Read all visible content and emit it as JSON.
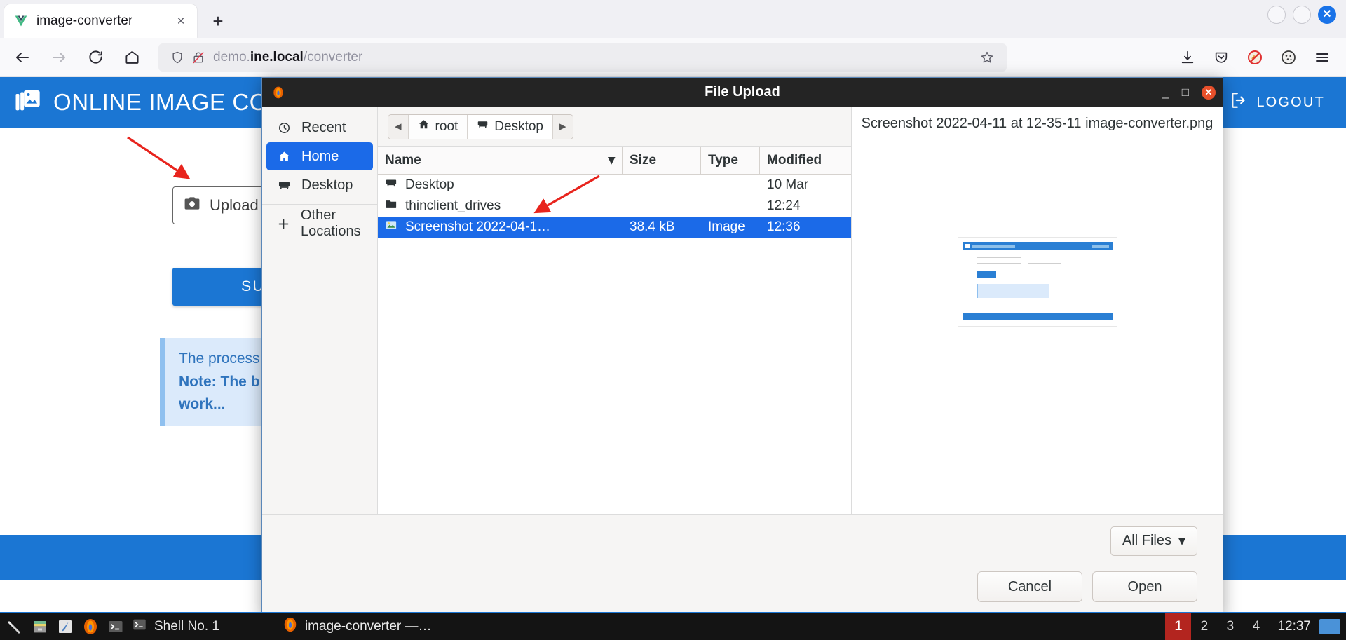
{
  "browser": {
    "tab": {
      "title": "image-converter",
      "favicon": "vue-logo-icon",
      "close": "×"
    },
    "new_tab_label": "+",
    "window_controls": {
      "minimize": "",
      "maximize": "",
      "close": "✕"
    },
    "nav": {
      "back": "back-arrow-icon",
      "forward": "forward-arrow-icon",
      "reload": "reload-icon",
      "home": "home-icon"
    },
    "url": {
      "prefix": "demo.",
      "domain": "ine.local",
      "path": "/converter",
      "full": "demo.ine.local/converter"
    },
    "url_icons": {
      "shield": "shield-icon",
      "lock": "lock-crossed-icon",
      "bookmark": "star-icon"
    },
    "toolbar_icons": [
      "download-icon",
      "pocket-icon",
      "tracking-blocked-icon",
      "cookie-icon",
      "menu-icon"
    ]
  },
  "page": {
    "brand": "ONLINE IMAGE CONVERTER",
    "brand_icon": "image-stack-icon",
    "logout_label": "LOGOUT",
    "logout_icon": "logout-icon",
    "upload_label": "Upload a file",
    "upload_icon": "camera-icon",
    "submit_label": "SUBMIT",
    "alert_line1": "The process might take a few seconds.",
    "alert_line2": "Note: The b",
    "alert_line3": "work...",
    "accent": "#1b76d3"
  },
  "dialog": {
    "title": "File Upload",
    "app_icon": "firefox-icon",
    "controls": {
      "minimize": "_",
      "maximize": "□",
      "close": "✕"
    },
    "sidebar": [
      {
        "label": "Recent",
        "icon": "clock-icon",
        "active": false
      },
      {
        "label": "Home",
        "icon": "home-icon",
        "active": true
      },
      {
        "label": "Desktop",
        "icon": "desktop-icon",
        "active": false
      },
      {
        "label": "Other Locations",
        "icon": "plus-icon",
        "active": false
      }
    ],
    "path": {
      "prev": "◂",
      "next": "▸",
      "crumbs": [
        {
          "label": "root",
          "icon": "home-icon",
          "current": false
        },
        {
          "label": "Desktop",
          "icon": "desktop-icon",
          "current": true
        }
      ]
    },
    "columns": {
      "name": "Name",
      "size": "Size",
      "type": "Type",
      "modified": "Modified",
      "sort": "▾"
    },
    "files": [
      {
        "name": "Desktop",
        "icon": "desktop-icon",
        "size": "",
        "type": "",
        "modified": "10 Mar",
        "selected": false
      },
      {
        "name": "thinclient_drives",
        "icon": "folder-icon",
        "size": "",
        "type": "",
        "modified": "12:24",
        "selected": false
      },
      {
        "name": "Screenshot 2022-04-1…",
        "icon": "image-icon",
        "size": "38.4  kB",
        "type": "Image",
        "modified": "12:36",
        "selected": true
      }
    ],
    "preview": {
      "filename": "Screenshot 2022-04-11 at 12-35-11 image-converter.png"
    },
    "filter": {
      "label": "All Files",
      "caret": "▾"
    },
    "actions": {
      "cancel": "Cancel",
      "open": "Open"
    }
  },
  "taskbar": {
    "launchers": [
      "xkill-icon",
      "files-icon",
      "editor-icon",
      "firefox-icon",
      "terminal-icon"
    ],
    "shell_label": "Shell No. 1",
    "shell_icon": "terminal-icon",
    "window_label": "image-converter —…",
    "window_icon": "firefox-icon",
    "workspaces": [
      "1",
      "2",
      "3",
      "4"
    ],
    "active_workspace": "1",
    "clock": "12:37",
    "show_desktop": "show-desktop-icon"
  }
}
